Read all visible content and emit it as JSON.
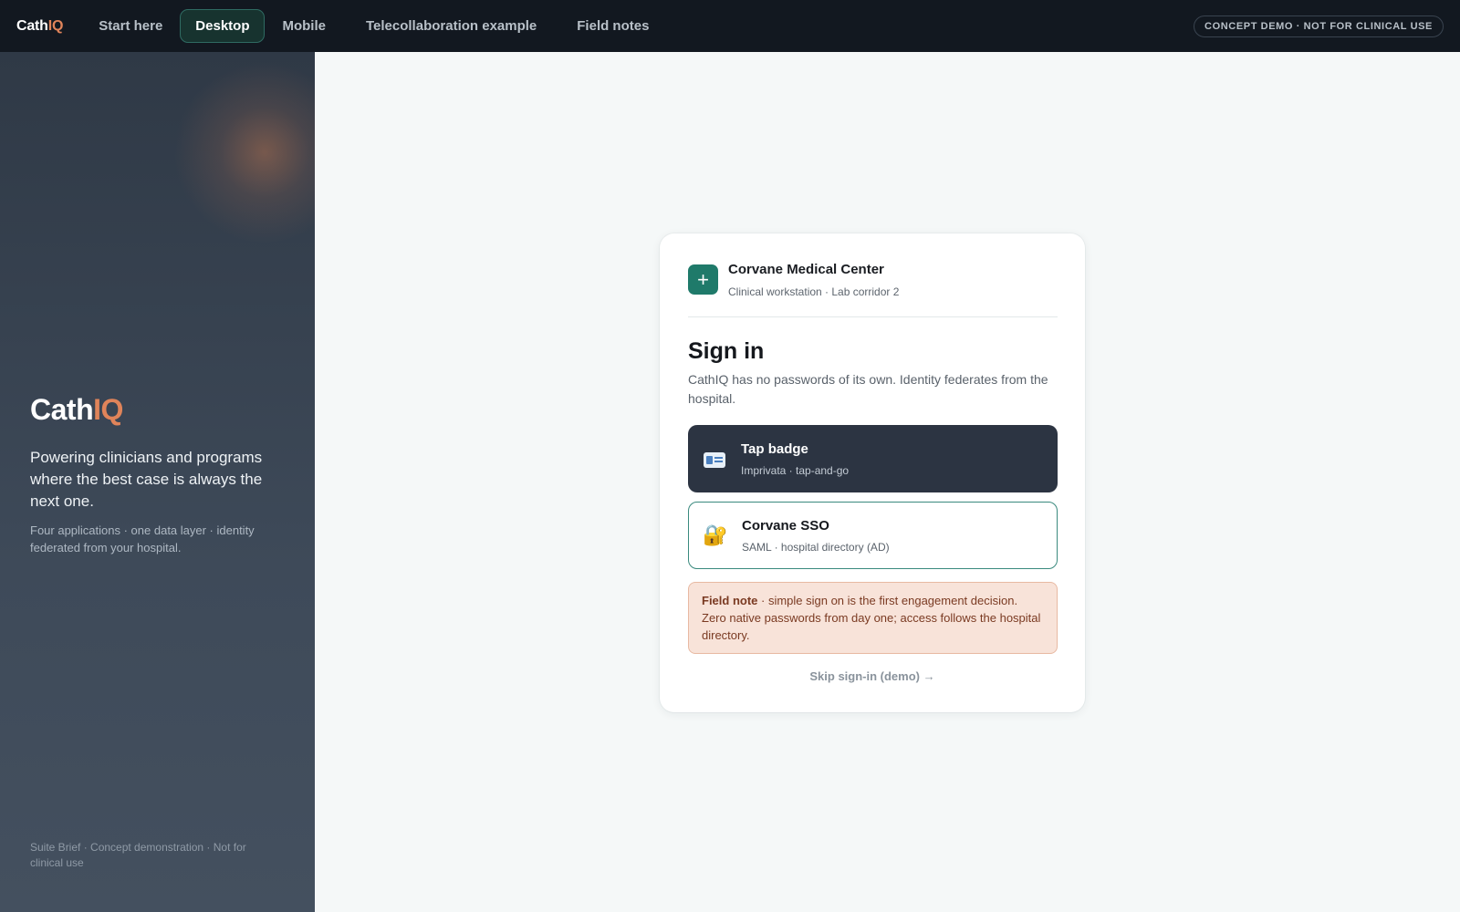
{
  "topbar": {
    "brand_main": "Cath",
    "brand_accent": "IQ",
    "tabs": [
      {
        "label": "Start here"
      },
      {
        "label": "Desktop"
      },
      {
        "label": "Mobile"
      },
      {
        "label": "Telecollaboration example"
      },
      {
        "label": "Field notes"
      }
    ],
    "active_tab": "Desktop",
    "badge": "CONCEPT DEMO · NOT FOR CLINICAL USE"
  },
  "sidebar": {
    "brand_main": "Cath",
    "brand_accent": "IQ",
    "tagline": "Powering clinicians and programs where the best case is always the next one.",
    "subtitle": "Four applications · one data layer · identity federated from your hospital.",
    "footer": "Suite Brief · Concept demonstration · Not for clinical use"
  },
  "card": {
    "org_icon": "plus-icon",
    "org_name": "Corvane Medical Center",
    "org_sub": "Clinical workstation · Lab corridor 2",
    "title": "Sign in",
    "description": "CathIQ has no passwords of its own. Identity federates from the hospital.",
    "options": [
      {
        "icon": "id-card-icon",
        "title": "Tap badge",
        "subtitle": "Imprivata · tap-and-go"
      },
      {
        "icon": "lock-key-icon",
        "glyph": "🔐",
        "title": "Corvane SSO",
        "subtitle": "SAML · hospital directory (AD)"
      }
    ],
    "note_label": "Field note",
    "note_text": " · simple sign on is the first engagement decision. Zero native passwords from day one; access follows the hospital directory.",
    "skip_label": "Skip sign-in (demo) →"
  },
  "colors": {
    "accent": "#e0845a",
    "teal": "#1f7a6a",
    "topbar_bg": "#121820",
    "badge_button_bg": "#2c3442",
    "note_bg": "#f8e3d9"
  }
}
